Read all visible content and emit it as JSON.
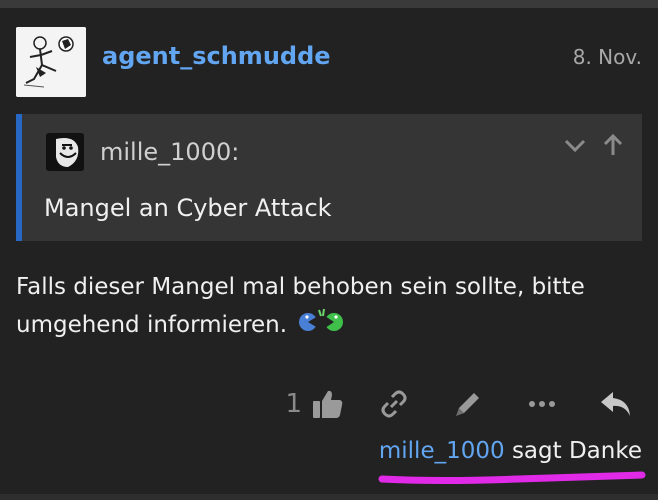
{
  "post": {
    "author": "agent_schmudde",
    "date": "8. Nov.",
    "avatar_icon": "soccer-player-sketch",
    "quote": {
      "author": "mille_1000:",
      "text": "Mangel an Cyber Attack",
      "collapse_icon": "chevron-down-icon",
      "jump_icon": "arrow-up-icon"
    },
    "body": "Falls dieser Mangel mal behoben sein sollte, bitte umgehend informieren.",
    "emoji_icon": "pacman-chase-emoji"
  },
  "actions": {
    "like_count": "1",
    "icons": [
      "thumbs-up-icon",
      "link-icon",
      "pencil-icon",
      "more-dots-icon",
      "reply-icon"
    ]
  },
  "thanks": {
    "user": "mille_1000",
    "text": " sagt Danke"
  },
  "colors": {
    "background": "#222222",
    "link": "#62a5f0",
    "quote_bg": "#353535",
    "quote_border": "#2668c3",
    "highlight": "#e02ae8"
  }
}
